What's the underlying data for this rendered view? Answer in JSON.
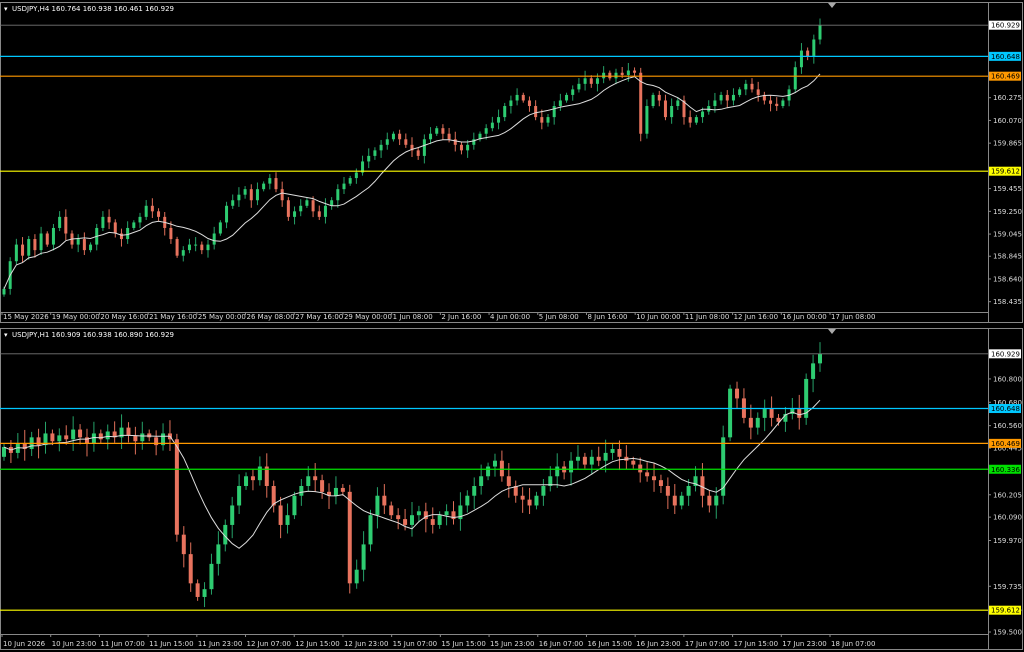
{
  "panes": [
    {
      "id": "h4",
      "title": "USDJPY,H4",
      "ohlc": "160.764 160.938 160.461 160.929",
      "price_min": 158.36,
      "price_max": 161.03,
      "price_labels": [
        "160.929",
        "160.275",
        "160.070",
        "159.865",
        "159.455",
        "159.250",
        "159.045",
        "158.845",
        "158.640",
        "158.435"
      ],
      "time_labels": [
        "15 May 2026",
        "19 May 00:00",
        "20 May 16:00",
        "21 May 16:00",
        "25 May 00:00",
        "26 May 08:00",
        "27 May 16:00",
        "29 May 00:00",
        "1 Jun 08:00",
        "2 Jun 16:00",
        "4 Jun 00:00",
        "5 Jun 08:00",
        "8 Jun 16:00",
        "10 Jun 00:00",
        "11 Jun 08:00",
        "12 Jun 16:00",
        "16 Jun 00:00",
        "17 Jun 08:00"
      ],
      "levels": [
        {
          "price": 160.648,
          "label": "160.648",
          "color": "#00c8ff"
        },
        {
          "price": 160.469,
          "label": "160.469",
          "color": "#ff9900"
        },
        {
          "price": 159.612,
          "label": "159.612",
          "color": "#ffff00"
        }
      ],
      "current_price": "160.929",
      "closes": [
        158.55,
        158.8,
        158.95,
        158.85,
        159.0,
        158.9,
        159.05,
        158.95,
        159.1,
        159.2,
        159.05,
        158.95,
        159.0,
        158.9,
        158.95,
        159.1,
        159.2,
        159.15,
        159.05,
        159.0,
        159.1,
        159.15,
        159.2,
        159.3,
        159.25,
        159.2,
        159.1,
        159.0,
        158.85,
        158.9,
        158.95,
        158.95,
        158.9,
        158.95,
        159.05,
        159.15,
        159.3,
        159.35,
        159.4,
        159.45,
        159.35,
        159.45,
        159.5,
        159.55,
        159.45,
        159.35,
        159.2,
        159.25,
        159.3,
        159.35,
        159.25,
        159.2,
        159.3,
        159.35,
        159.45,
        159.5,
        159.55,
        159.6,
        159.7,
        159.75,
        159.8,
        159.85,
        159.9,
        159.95,
        159.9,
        159.85,
        159.8,
        159.75,
        159.9,
        159.95,
        160.0,
        159.95,
        159.9,
        159.85,
        159.8,
        159.85,
        159.9,
        159.95,
        160.0,
        160.05,
        160.1,
        160.2,
        160.25,
        160.3,
        160.25,
        160.2,
        160.1,
        160.05,
        160.1,
        160.2,
        160.25,
        160.3,
        160.35,
        160.4,
        160.45,
        160.4,
        160.45,
        160.5,
        160.45,
        160.5,
        160.48,
        160.52,
        160.5,
        159.95,
        160.2,
        160.3,
        160.25,
        160.1,
        160.2,
        160.25,
        160.1,
        160.05,
        160.1,
        160.15,
        160.2,
        160.25,
        160.3,
        160.25,
        160.3,
        160.35,
        160.4,
        160.35,
        160.3,
        160.25,
        160.22,
        160.2,
        160.25,
        160.35,
        160.55,
        160.7,
        160.65,
        160.8,
        160.929
      ]
    },
    {
      "id": "h1",
      "title": "USDJPY,H1",
      "ohlc": "160.909 160.938 160.890 160.929",
      "price_min": 159.5,
      "price_max": 161.0,
      "price_labels": [
        "160.929",
        "160.800",
        "160.680",
        "160.560",
        "160.445",
        "160.205",
        "160.090",
        "159.970",
        "159.735",
        "159.615",
        "159.500"
      ],
      "time_labels": [
        "10 Jun 2026",
        "10 Jun 23:00",
        "11 Jun 07:00",
        "11 Jun 15:00",
        "11 Jun 23:00",
        "12 Jun 07:00",
        "12 Jun 15:00",
        "12 Jun 23:00",
        "15 Jun 07:00",
        "15 Jun 15:00",
        "15 Jun 23:00",
        "16 Jun 07:00",
        "16 Jun 15:00",
        "16 Jun 23:00",
        "17 Jun 07:00",
        "17 Jun 15:00",
        "17 Jun 23:00",
        "18 Jun 07:00"
      ],
      "levels": [
        {
          "price": 160.648,
          "label": "160.648",
          "color": "#00c8ff"
        },
        {
          "price": 160.469,
          "label": "160.469",
          "color": "#ff9900"
        },
        {
          "price": 160.336,
          "label": "160.336",
          "color": "#00e000"
        },
        {
          "price": 159.612,
          "label": "159.612",
          "color": "#ffff00"
        }
      ],
      "current_price": "160.929",
      "closes": [
        160.45,
        160.42,
        160.47,
        160.44,
        160.5,
        160.46,
        160.52,
        160.48,
        160.51,
        160.49,
        160.54,
        160.5,
        160.47,
        160.52,
        160.49,
        160.53,
        160.5,
        160.55,
        160.51,
        160.48,
        160.52,
        160.5,
        160.46,
        160.52,
        160.49,
        160.0,
        159.9,
        159.75,
        159.68,
        159.72,
        159.85,
        159.95,
        160.05,
        160.15,
        160.25,
        160.3,
        160.28,
        160.35,
        160.25,
        160.15,
        160.05,
        160.1,
        160.2,
        160.25,
        160.3,
        160.28,
        160.22,
        160.2,
        160.24,
        160.22,
        159.75,
        159.82,
        159.95,
        160.1,
        160.2,
        160.15,
        160.1,
        160.08,
        160.05,
        160.1,
        160.12,
        160.08,
        160.05,
        160.1,
        160.12,
        160.08,
        160.15,
        160.2,
        160.25,
        160.3,
        160.35,
        160.38,
        160.3,
        160.25,
        160.2,
        160.18,
        160.15,
        160.2,
        160.25,
        160.3,
        160.35,
        160.32,
        160.38,
        160.4,
        160.36,
        160.4,
        160.38,
        160.42,
        160.44,
        160.4,
        160.38,
        160.36,
        160.32,
        160.3,
        160.28,
        160.25,
        160.2,
        160.15,
        160.2,
        160.25,
        160.3,
        160.2,
        160.15,
        160.2,
        160.5,
        160.75,
        160.7,
        160.6,
        160.55,
        160.6,
        160.65,
        160.6,
        160.58,
        160.62,
        160.65,
        160.6,
        160.8,
        160.88,
        160.929
      ]
    }
  ]
}
